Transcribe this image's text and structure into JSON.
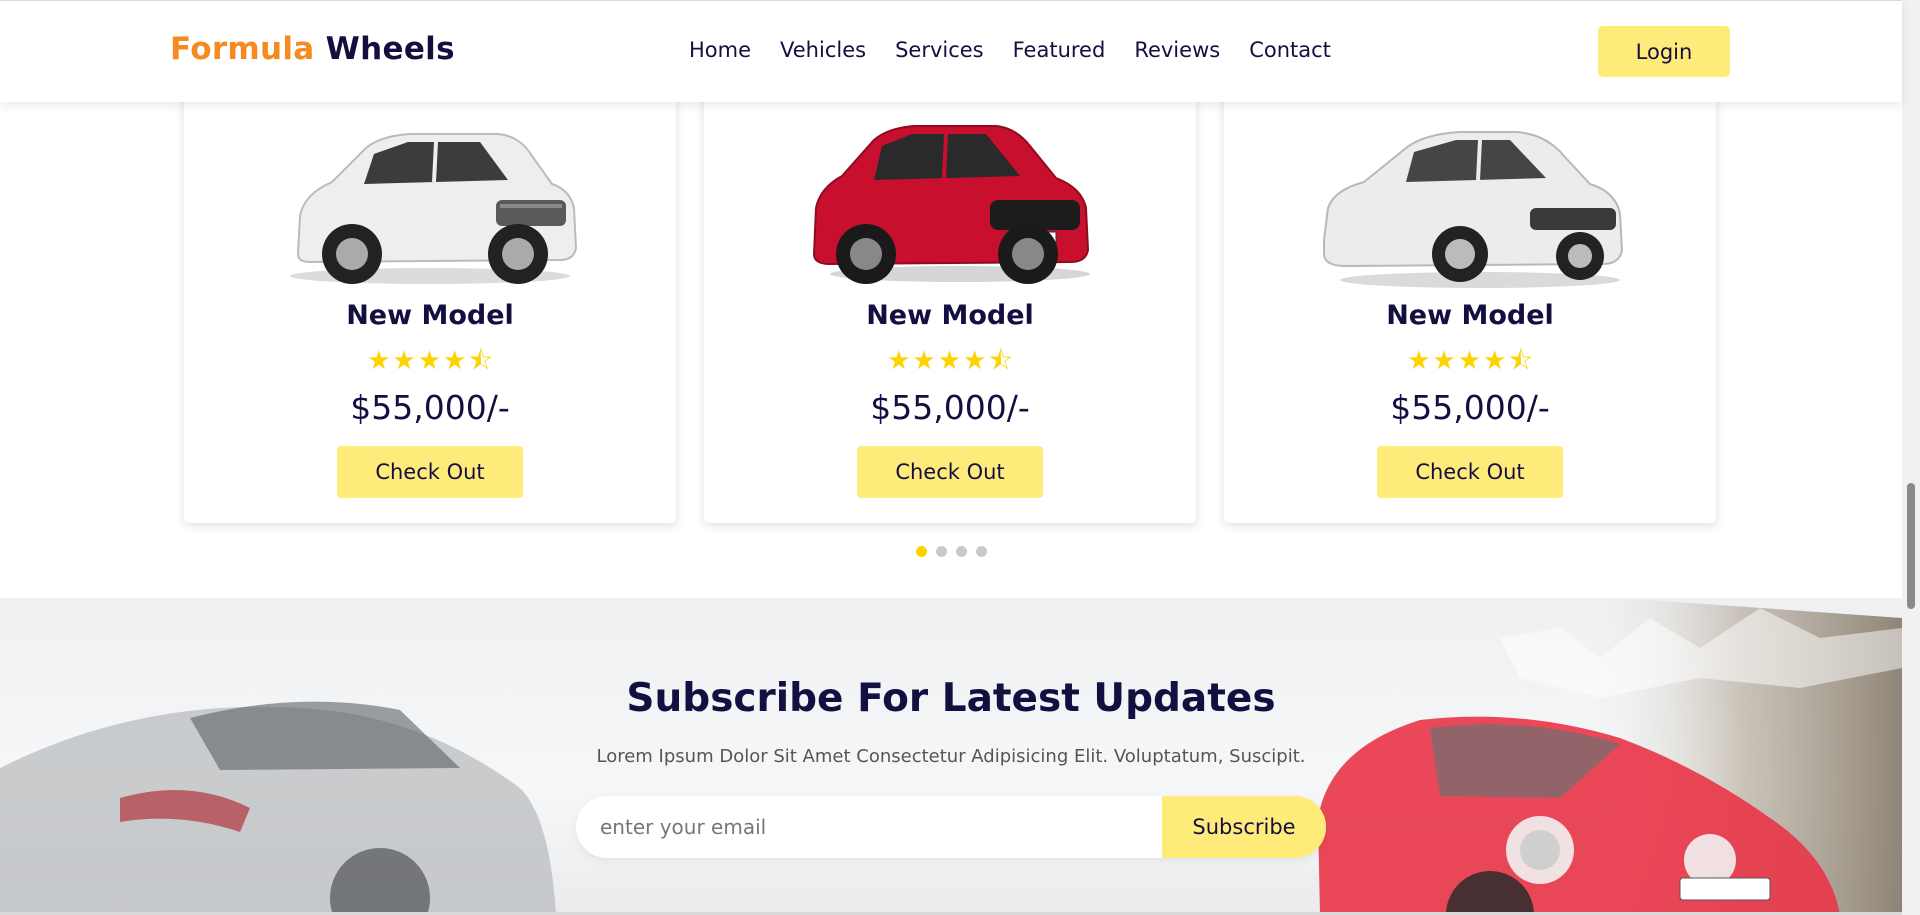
{
  "header": {
    "logo_part1": "Formula",
    "logo_part2": "Wheels",
    "nav": [
      "Home",
      "Vehicles",
      "Services",
      "Featured",
      "Reviews",
      "Contact"
    ],
    "login_label": "Login"
  },
  "cards": [
    {
      "title": "New Model",
      "rating": 4.5,
      "price": "$55,000/-",
      "button": "Check Out",
      "car_color": "#e6e6e6",
      "car_type": "suv"
    },
    {
      "title": "New Model",
      "rating": 4.5,
      "price": "$55,000/-",
      "button": "Check Out",
      "car_color": "#c8102e",
      "car_type": "compact-suv"
    },
    {
      "title": "New Model",
      "rating": 4.5,
      "price": "$55,000/-",
      "button": "Check Out",
      "car_color": "#e9e9e9",
      "car_type": "sedan"
    }
  ],
  "pagination": {
    "count": 4,
    "active": 0
  },
  "subscribe": {
    "title": "Subscribe For Latest Updates",
    "text": "Lorem Ipsum Dolor Sit Amet Consectetur Adipisicing Elit. Voluptatum, Suscipit.",
    "placeholder": "enter your email",
    "button": "Subscribe"
  },
  "colors": {
    "accent_orange": "#f6891f",
    "navy": "#130f40",
    "button_yellow": "#ffeb7a",
    "star_yellow": "#ffd300"
  },
  "icons": {
    "star": "star-icon",
    "half_star": "star-half-icon"
  }
}
